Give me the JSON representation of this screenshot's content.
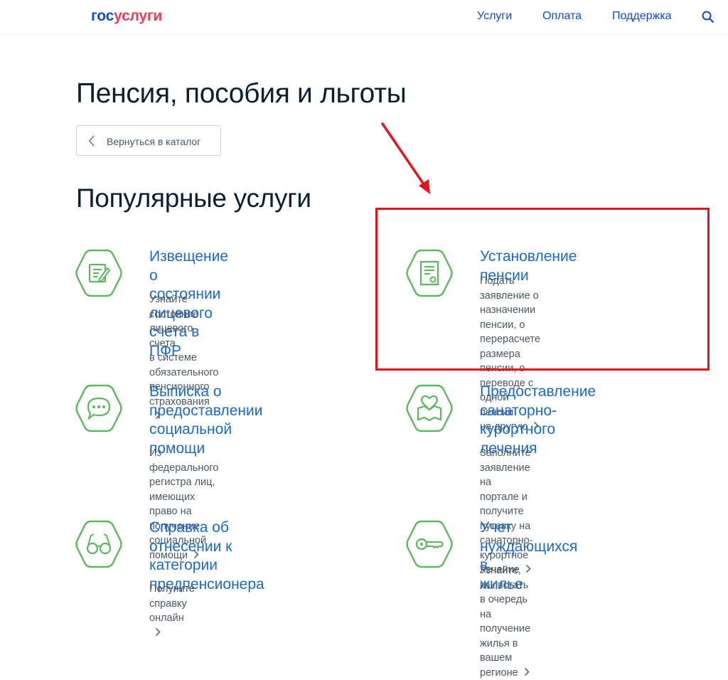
{
  "header": {
    "logo_part1": "гос",
    "logo_part2": "услуги",
    "nav": [
      "Услуги",
      "Оплата",
      "Поддержка"
    ],
    "search_icon": "search-icon"
  },
  "page": {
    "title": "Пенсия, пособия и льготы",
    "back_label": "Вернуться в каталог",
    "section_title": "Популярные услуги"
  },
  "colors": {
    "brand_blue": "#0d4cd3",
    "brand_red": "#ee3f58",
    "icon_green": "#5cb85c",
    "link": "#1a6ac8",
    "annotation": "#e8121c"
  },
  "cards": [
    {
      "icon": "document-edit-icon",
      "title_lines": [
        "Извещение о состоянии",
        "лицевого счета в ПФР"
      ],
      "desc_lines": [
        "Узнайте состояние лицевого счета",
        "в системе обязательного",
        "пенсионного страхования"
      ]
    },
    {
      "icon": "document-icon",
      "title_lines": [
        "Установление пенсии"
      ],
      "desc_lines": [
        "Подать заявление о назначении",
        "пенсии, о перерасчете размера",
        "пенсии, о переводе с одной пенсии",
        "на другую"
      ]
    },
    {
      "icon": "chat-bubble-icon",
      "title_lines": [
        "Выписка о",
        "предоставлении",
        "социальной помощи"
      ],
      "desc_lines": [
        "Из федерального регистра лиц,",
        "имеющих право на получение",
        "социальной помощи"
      ]
    },
    {
      "icon": "heart-map-icon",
      "title_lines": [
        "Предоставление",
        "санаторно-курортного",
        "лечения"
      ],
      "desc_lines": [
        "Заполните заявление на портале и",
        "получите путевку на санаторно-",
        "курортное лечение"
      ]
    },
    {
      "icon": "glasses-icon",
      "title_lines": [
        "Справка об отнесении к",
        "категории",
        "предпенсионера"
      ],
      "desc_lines": [
        "Получите справку онлайн"
      ]
    },
    {
      "icon": "key-icon",
      "title_lines": [
        "Учет нуждающихся в",
        "жилье"
      ],
      "desc_lines": [
        "Узнайте, как встать в очередь на",
        "получение жилья в вашем регионе"
      ]
    }
  ]
}
